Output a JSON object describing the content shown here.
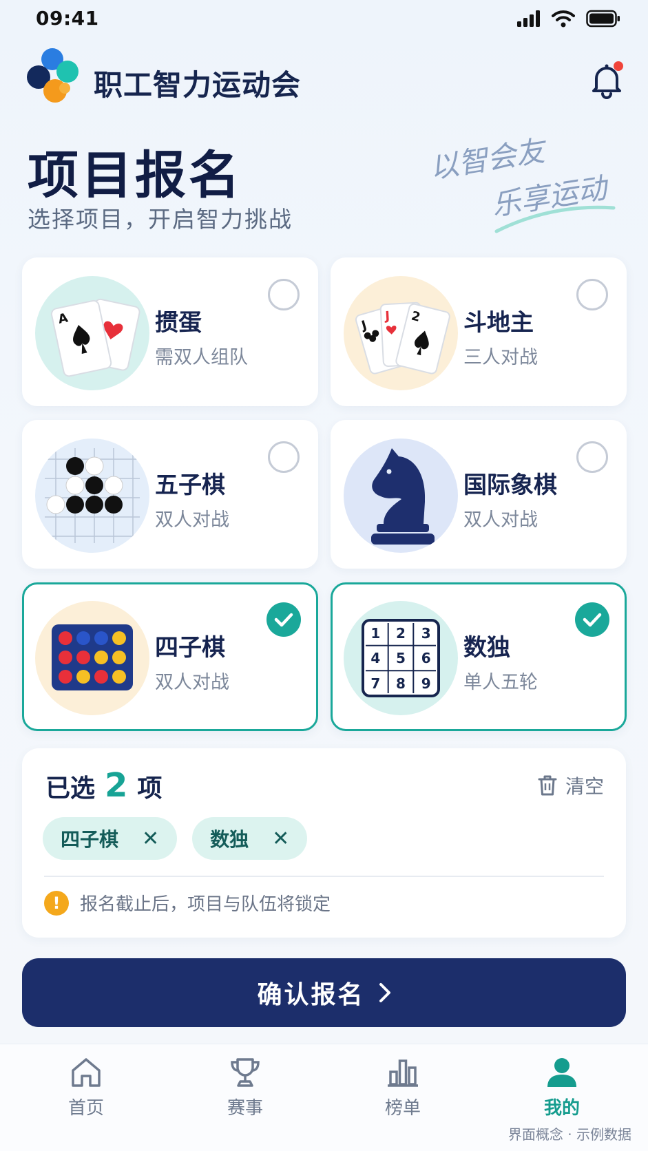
{
  "status_bar": {
    "time": "09:41"
  },
  "header": {
    "app_title": "职工智力运动会"
  },
  "hero": {
    "title": "项目报名",
    "subtitle": "选择项目，开启智力挑战",
    "slogan_line1": "以智会友",
    "slogan_line2": "乐享运动"
  },
  "events": [
    {
      "name": "掼蛋",
      "desc": "需双人组队",
      "selected": false
    },
    {
      "name": "斗地主",
      "desc": "三人对战",
      "selected": false
    },
    {
      "name": "五子棋",
      "desc": "双人对战",
      "selected": false
    },
    {
      "name": "国际象棋",
      "desc": "双人对战",
      "selected": false
    },
    {
      "name": "四子棋",
      "desc": "双人对战",
      "selected": true
    },
    {
      "name": "数独",
      "desc": "单人五轮",
      "selected": true
    }
  ],
  "summary": {
    "prefix": "已选",
    "count": "2",
    "suffix": "项",
    "clear_label": "清空",
    "chips": [
      "四子棋",
      "数独"
    ],
    "notice": "报名截止后，项目与队伍将锁定"
  },
  "confirm": {
    "label": "确认报名"
  },
  "tabbar": {
    "items": [
      {
        "label": "首页",
        "icon": "home-icon"
      },
      {
        "label": "赛事",
        "icon": "trophy-icon"
      },
      {
        "label": "榜单",
        "icon": "chart-icon"
      },
      {
        "label": "我的",
        "icon": "user-icon",
        "active": true
      }
    ]
  },
  "footnote": "界面概念 · 示例数据",
  "colors": {
    "accent": "#1aa89a",
    "primary": "#1c2e6b",
    "warning": "#f4a81c",
    "notification": "#f0443a"
  }
}
